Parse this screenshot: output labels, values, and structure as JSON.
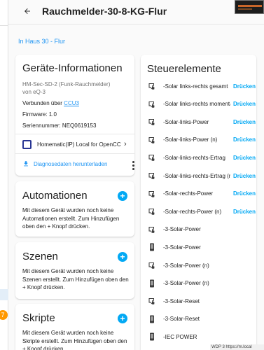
{
  "header": {
    "title": "Rauchmelder-30-8-KG-Flur"
  },
  "area_link": "In Haus 30 - Flur",
  "device_info": {
    "title": "Geräte-Informationen",
    "model": "HM-Sec-SD-2 (Funk-Rauchmelder)",
    "manufacturer": "von eQ-3",
    "connected_prefix": "Verbunden über",
    "connected_link": "CCU3",
    "firmware": "Firmware: 1.0",
    "serial": "Seriennummer: NEQ0619153",
    "integration": "Homematic(IP) Local for OpenCCU",
    "download_label": "Diagnosedaten herunterladen"
  },
  "automations": {
    "title": "Automationen",
    "text": "Mit diesem Gerät wurden noch keine Automationen erstellt. Zum Hinzufügen oben den + Knopf drücken."
  },
  "scenes": {
    "title": "Szenen",
    "text": "Mit diesem Gerät wurden noch keine Szenen erstellt. Zum Hinzufügen oben den + Knopf drücken."
  },
  "scripts": {
    "title": "Skripte",
    "text": "Mit diesem Gerät wurden noch keine Skripte erstellt. Zum Hinzufügen oben den + Knopf drücken."
  },
  "controls": {
    "title": "Steuerelemente",
    "items": [
      {
        "name": "-Solar links-rechts gesamt",
        "action": "Drücken",
        "icon": "gesture-tap-button-icon"
      },
      {
        "name": "-Solar links-rechts momentan",
        "action": "Drücken",
        "icon": "gesture-tap-button-icon"
      },
      {
        "name": "-Solar-links-Power",
        "action": "Drücken",
        "icon": "gesture-tap-button-icon"
      },
      {
        "name": "-Solar-links-Power (n)",
        "action": "Drücken",
        "icon": "gesture-tap-button-icon"
      },
      {
        "name": "-Solar-links-rechts-Ertrag",
        "action": "Drücken",
        "icon": "gesture-tap-button-icon"
      },
      {
        "name": "-Solar-links-rechts-Ertrag (n)",
        "action": "Drücken",
        "icon": "gesture-tap-button-icon"
      },
      {
        "name": "-Solar-rechts-Power",
        "action": "Drücken",
        "icon": "gesture-tap-button-icon"
      },
      {
        "name": "-Solar-rechts-Power (n)",
        "action": "Drücken",
        "icon": "gesture-tap-button-icon"
      },
      {
        "name": "-3-Solar-Power",
        "action": "",
        "icon": "gesture-tap-button-icon"
      },
      {
        "name": "-3-Solar-Power",
        "action": "",
        "icon": "cellphone-icon"
      },
      {
        "name": "-3-Solar-Power (n)",
        "action": "",
        "icon": "gesture-tap-button-icon"
      },
      {
        "name": "-3-Solar-Power (n)",
        "action": "",
        "icon": "cellphone-icon"
      },
      {
        "name": "-3-Solar-Reset",
        "action": "",
        "icon": "gesture-tap-button-icon"
      },
      {
        "name": "-3-Solar-Reset",
        "action": "",
        "icon": "cellphone-icon"
      },
      {
        "name": "-IEC POWER",
        "action": "",
        "icon": "cellphone-icon"
      }
    ]
  },
  "statusbar_text": "WDP 3 https://m.local",
  "sidebar_badge": "7",
  "colors": {
    "accent": "#03a9f4",
    "link": "#2196f3",
    "badge": "#ff9800"
  }
}
